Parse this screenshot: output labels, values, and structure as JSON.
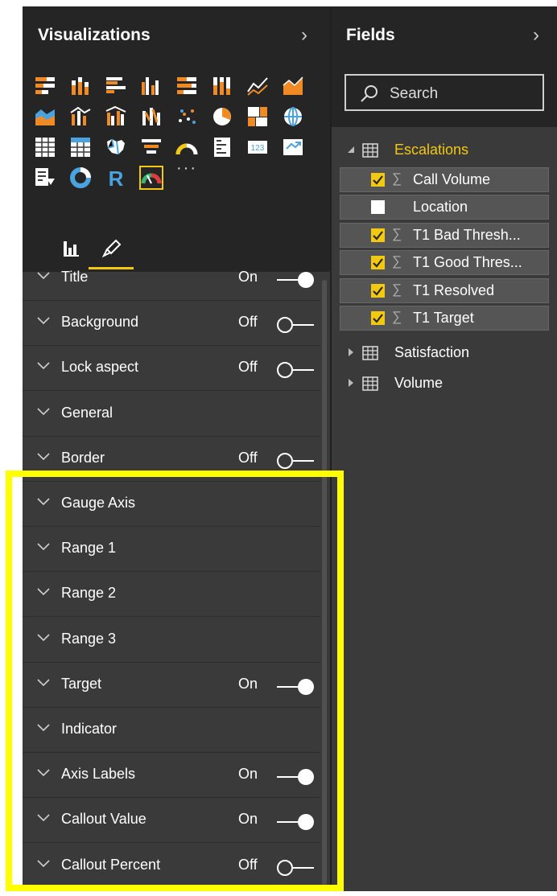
{
  "visualizations": {
    "title": "Visualizations",
    "icons": [
      "stacked-bar-chart-icon",
      "stacked-column-chart-icon",
      "clustered-bar-chart-icon",
      "clustered-column-chart-icon",
      "100-stacked-bar-chart-icon",
      "100-stacked-column-chart-icon",
      "line-chart-icon",
      "area-chart-icon",
      "stacked-area-chart-icon",
      "line-and-stacked-column-chart-icon",
      "line-and-clustered-column-chart-icon",
      "ribbon-chart-icon",
      "scatter-chart-icon",
      "pie-chart-icon",
      "treemap-icon",
      "map-icon",
      "table-icon",
      "matrix-icon",
      "filled-map-icon",
      "funnel-icon",
      "gauge-icon",
      "multi-row-card-icon",
      "card-icon",
      "kpi-icon",
      "slicer-icon",
      "donut-chart-icon",
      "r-script-visual-icon",
      "gauge-selected-icon"
    ],
    "more_label": "···",
    "tabs": [
      {
        "name": "fields-tab",
        "icon": "fields-icon",
        "active": false
      },
      {
        "name": "format-tab",
        "icon": "paint-roller-icon",
        "active": true
      }
    ],
    "sections": [
      {
        "label": "Title",
        "state": "On",
        "toggle": "on"
      },
      {
        "label": "Background",
        "state": "Off",
        "toggle": "off"
      },
      {
        "label": "Lock aspect",
        "state": "Off",
        "toggle": "off"
      },
      {
        "label": "General",
        "state": "",
        "toggle": "none"
      },
      {
        "label": "Border",
        "state": "Off",
        "toggle": "off"
      },
      {
        "label": "Gauge Axis",
        "state": "",
        "toggle": "none"
      },
      {
        "label": "Range 1",
        "state": "",
        "toggle": "none"
      },
      {
        "label": "Range 2",
        "state": "",
        "toggle": "none"
      },
      {
        "label": "Range 3",
        "state": "",
        "toggle": "none"
      },
      {
        "label": "Target",
        "state": "On",
        "toggle": "on"
      },
      {
        "label": "Indicator",
        "state": "",
        "toggle": "none"
      },
      {
        "label": "Axis Labels",
        "state": "On",
        "toggle": "on"
      },
      {
        "label": "Callout Value",
        "state": "On",
        "toggle": "on"
      },
      {
        "label": "Callout Percent",
        "state": "Off",
        "toggle": "off"
      }
    ]
  },
  "fields": {
    "title": "Fields",
    "search_placeholder": "Search",
    "tables": [
      {
        "name": "Escalations",
        "expanded": true,
        "fields": [
          {
            "label": "Call Volume",
            "checked": true,
            "sigma": true
          },
          {
            "label": "Location",
            "checked": false,
            "sigma": false
          },
          {
            "label": "T1 Bad Thresh...",
            "checked": true,
            "sigma": true
          },
          {
            "label": "T1 Good Thres...",
            "checked": true,
            "sigma": true
          },
          {
            "label": "T1 Resolved",
            "checked": true,
            "sigma": true
          },
          {
            "label": "T1 Target",
            "checked": true,
            "sigma": true
          }
        ]
      },
      {
        "name": "Satisfaction",
        "expanded": false
      },
      {
        "name": "Volume",
        "expanded": false
      }
    ]
  },
  "colors": {
    "accent": "#f2c811",
    "highlight": "#ffff00",
    "pane_bg": "#3a3a3a",
    "header_bg": "#252525"
  }
}
